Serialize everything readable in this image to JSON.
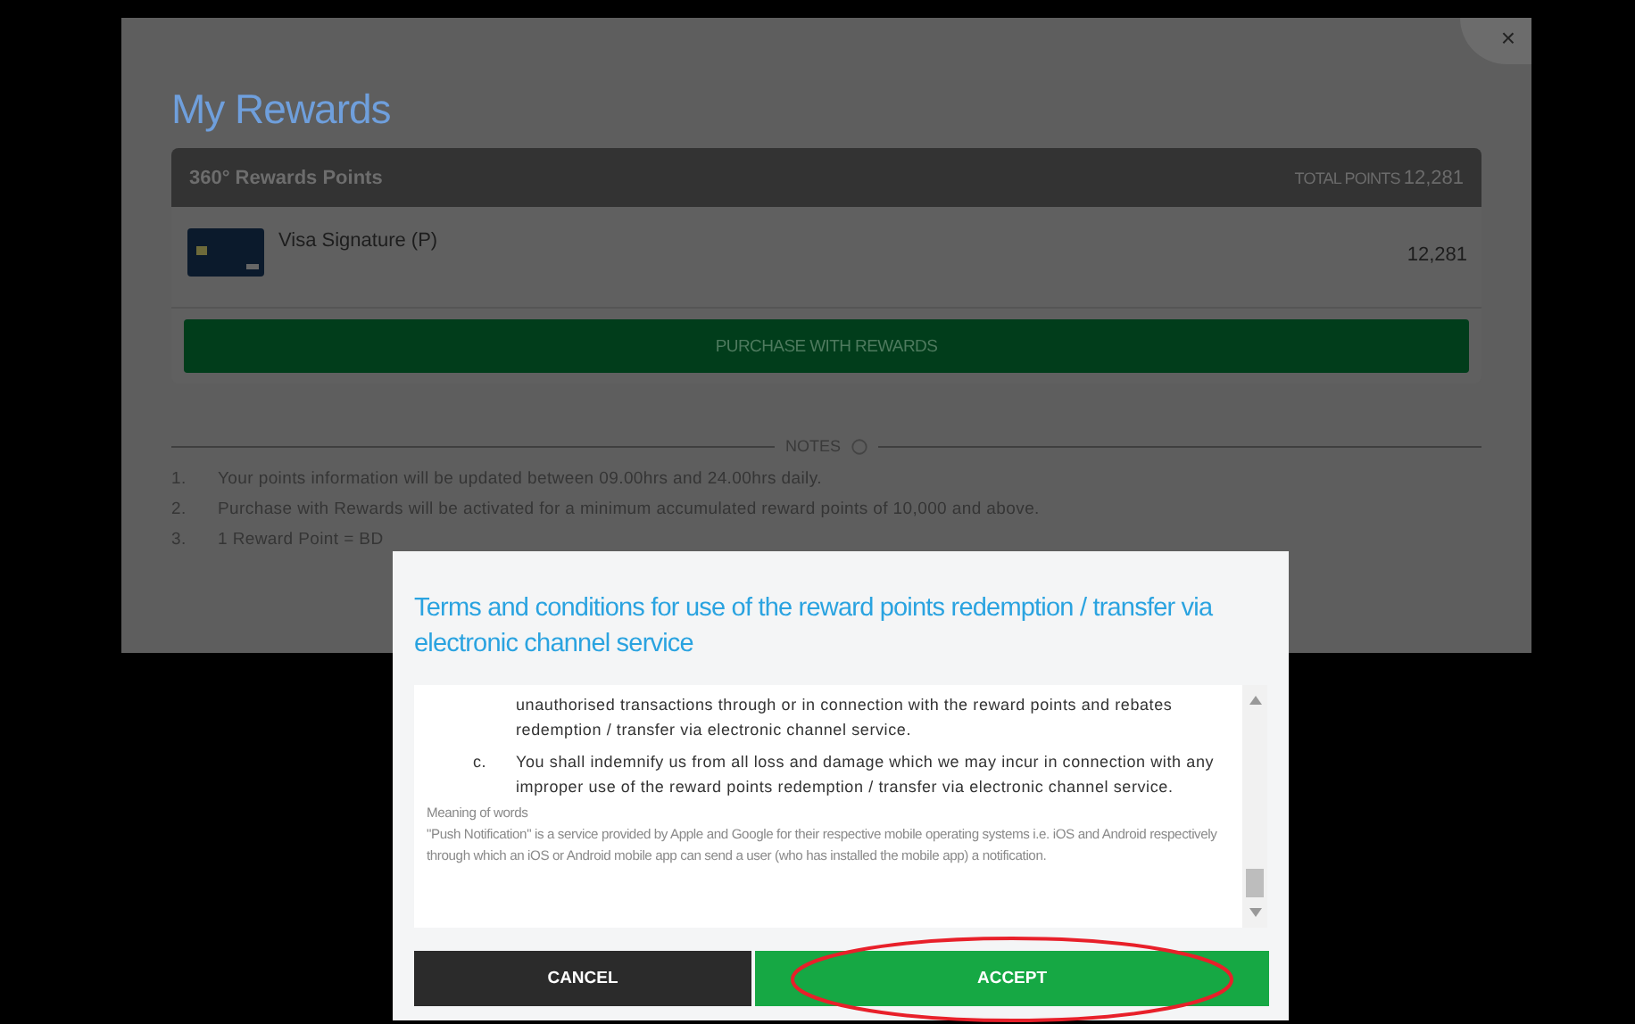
{
  "panel": {
    "title": "My Rewards",
    "close": "×",
    "rewards_header": {
      "label": "360° Rewards Points",
      "total_label": "TOTAL POINTS",
      "total_value": "12,281"
    },
    "cards": [
      {
        "name": "Visa Signature (P)",
        "points": "12,281"
      }
    ],
    "purchase_button": "PURCHASE WITH REWARDS",
    "notes_heading": "NOTES",
    "notes": [
      {
        "number": "1.",
        "text": "Your points information will be updated between 09.00hrs and 24.00hrs daily."
      },
      {
        "number": "2.",
        "text": "Purchase with Rewards will be activated for a minimum accumulated reward points of 10,000 and above."
      },
      {
        "number": "3.",
        "text": "1 Reward Point = BD"
      }
    ]
  },
  "modal": {
    "title": "Terms and conditions for use of the reward points redemption / transfer via electronic channel service",
    "terms": [
      {
        "kind": "continuation",
        "text": "unauthorised transactions through or in connection with the reward points and rebates redemption / transfer via electronic channel service."
      },
      {
        "kind": "item",
        "marker": "c.",
        "text": "You shall indemnify us from all loss and damage which we may incur in connection with any improper use of the reward points redemption / transfer via electronic channel service."
      },
      {
        "kind": "heading",
        "text": "Meaning of words"
      },
      {
        "kind": "paragraph",
        "text": "\"Push Notification\" is a service provided by Apple and Google for their respective mobile operating systems i.e. iOS and Android respectively through which an iOS or Android mobile app can send a user (who has installed the mobile app) a notification."
      }
    ],
    "buttons": [
      {
        "label": "CANCEL",
        "kind": "secondary",
        "highlighted": false
      },
      {
        "label": "ACCEPT",
        "kind": "primary",
        "highlighted": true
      }
    ]
  }
}
